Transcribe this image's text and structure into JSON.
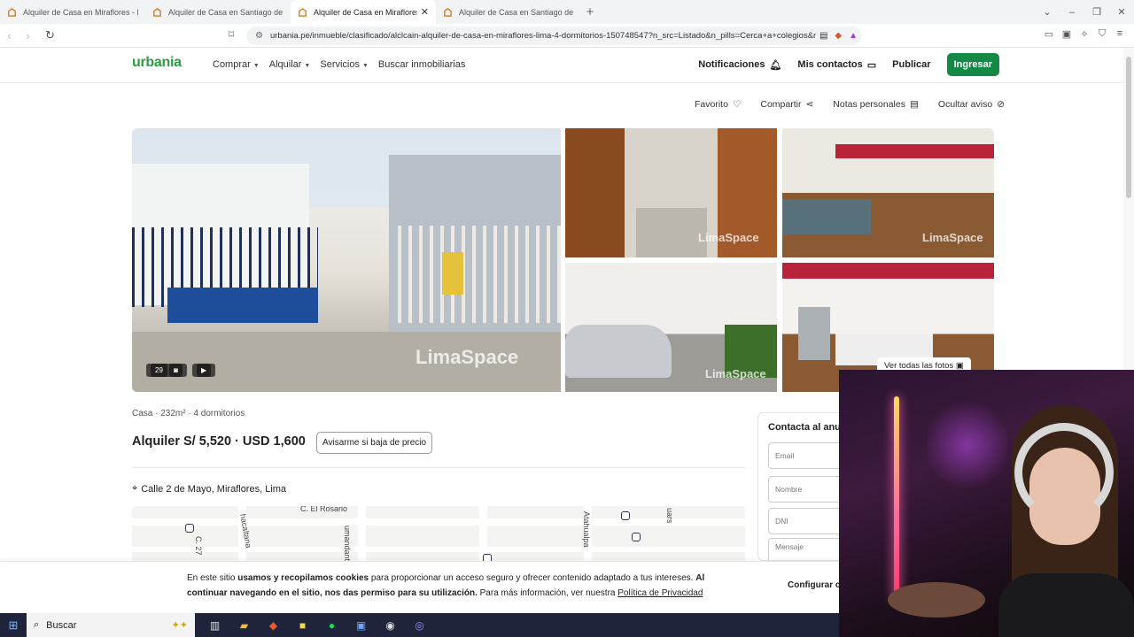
{
  "browser": {
    "tabs": [
      {
        "title": "Alquiler de Casa en Miraflores - Lima",
        "active": false
      },
      {
        "title": "Alquiler de Casa en Santiago de Surco",
        "active": false
      },
      {
        "title": "Alquiler de Casa en Miraflores - L",
        "active": true
      },
      {
        "title": "Alquiler de Casa en Santiago de Surco",
        "active": false
      }
    ],
    "url": "urbania.pe/inmueble/clasificado/alclcain-alquiler-de-casa-en-miraflores-lima-4-dormitorios-150748547?n_src=Listado&n_pills=Cerca+a+colegios&n..."
  },
  "header": {
    "logo": "urbania",
    "nav": [
      "Comprar",
      "Alquilar",
      "Servicios",
      "Buscar inmobiliarias"
    ],
    "notifications": "Notificaciones",
    "contacts": "Mis contactos",
    "publish": "Publicar",
    "login": "Ingresar"
  },
  "actions": {
    "favorite": "Favorito",
    "share": "Compartir",
    "notes": "Notas personales",
    "hide": "Ocultar aviso"
  },
  "gallery": {
    "photo_count": "29",
    "watermark": "LimaSpace",
    "see_all": "Ver todas las fotos"
  },
  "listing": {
    "summary": "Casa · 232m² · 4 dormitorios",
    "price": "Alquiler S/ 5,520 · USD 1,600",
    "price_alert": "Avisarme si baja de precio",
    "address": "Calle 2 de Mayo, Miraflores, Lima"
  },
  "map": {
    "labels": [
      "C. El Rosario",
      "umandante E",
      "Atahualpa",
      "uars",
      "hacaltana",
      "C. 27"
    ]
  },
  "contact": {
    "title": "Contacta al anunciante",
    "email": "Email",
    "name": "Nombre",
    "dni": "DNI",
    "message": "Mensaje"
  },
  "cookie": {
    "part1": "En este sitio ",
    "bold1": "usamos y recopilamos cookies",
    "part2": " para proporcionar un acceso seguro y ofrecer contenido adaptado a tus intereses. ",
    "bold2": "Al continuar navegando en el sitio, nos das permiso para su utilización.",
    "part3": " Para más información, ver nuestra ",
    "link": "Política de Privacidad",
    "configure": "Configurar cookies"
  },
  "taskbar": {
    "search": "Buscar"
  }
}
